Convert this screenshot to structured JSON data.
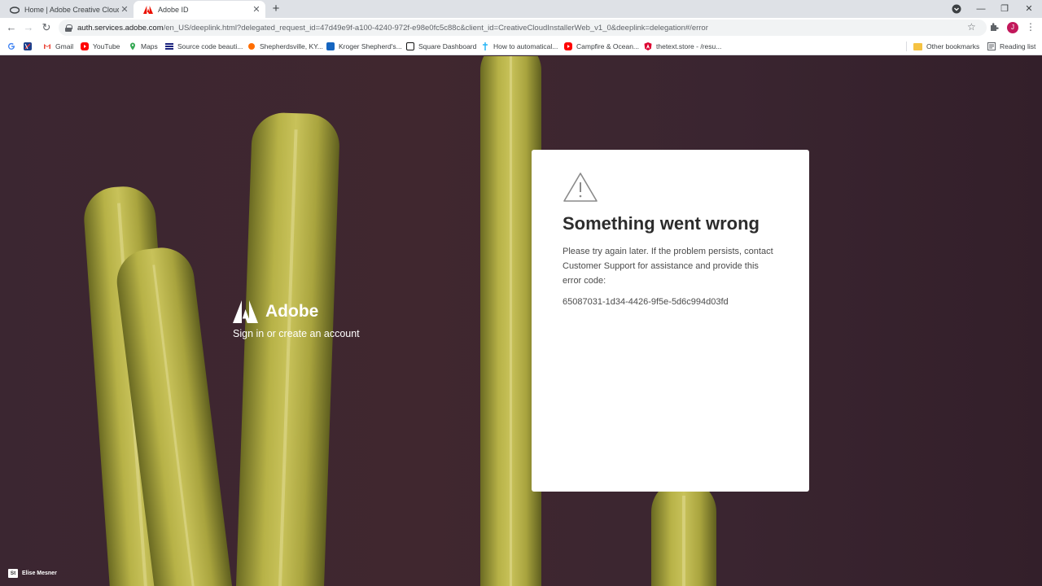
{
  "browser": {
    "tabs": [
      {
        "title": "Home | Adobe Creative Cloud"
      },
      {
        "title": "Adobe ID"
      }
    ],
    "url_host": "auth.services.adobe.com",
    "url_path": "/en_US/deeplink.html?delegated_request_id=47d49e9f-a100-4240-972f-e98e0fc5c88c&client_id=CreativeCloudInstallerWeb_v1_0&deeplink=delegation#/error",
    "avatar_letter": "J",
    "bookmarks": [
      {
        "label": "",
        "icon": "google-icon"
      },
      {
        "label": "",
        "icon": "bookmark-icon"
      },
      {
        "label": "Gmail",
        "icon": "gmail-icon"
      },
      {
        "label": "YouTube",
        "icon": "youtube-icon"
      },
      {
        "label": "Maps",
        "icon": "maps-icon"
      },
      {
        "label": "Source code beauti...",
        "icon": "list-icon"
      },
      {
        "label": "Shepherdsville, KY...",
        "icon": "sun-icon"
      },
      {
        "label": "Kroger Shepherd's...",
        "icon": "kroger-icon"
      },
      {
        "label": "Square Dashboard",
        "icon": "square-icon"
      },
      {
        "label": "How to automatical...",
        "icon": "pin-icon"
      },
      {
        "label": "Campfire & Ocean...",
        "icon": "youtube-icon"
      },
      {
        "label": "thetext.store - /resu...",
        "icon": "angular-icon"
      }
    ],
    "other_bookmarks": "Other bookmarks",
    "reading_list": "Reading list"
  },
  "brand": {
    "name": "Adobe",
    "tagline": "Sign in or create an account"
  },
  "error": {
    "title": "Something went wrong",
    "message": "Please try again later. If the problem persists, contact Customer Support for assistance and provide this error code:",
    "code": "65087031-1d34-4426-9f5e-5d6c994d03fd"
  },
  "photo_credit": {
    "badge": "St",
    "name": "Elise Mesner"
  },
  "colors": {
    "adobe_red": "#eb1000",
    "background": "#3a2530",
    "cactus": "#c8c25a"
  }
}
